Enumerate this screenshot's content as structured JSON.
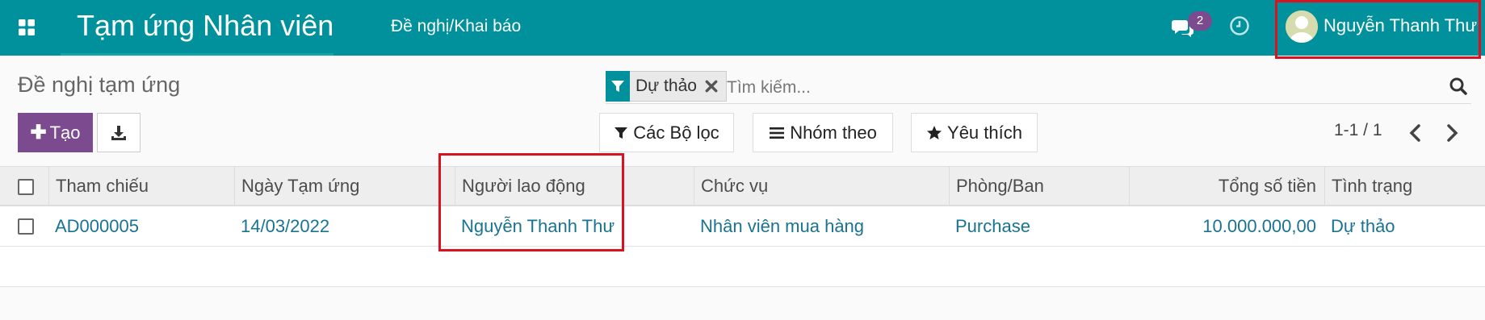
{
  "navbar": {
    "app_title": "Tạm ứng Nhân viên",
    "menu_item": "Đề nghị/Khai báo",
    "messages_count": "2",
    "user_name": "Nguyễn Thanh Thư",
    "bg_color": "#00919c"
  },
  "control_panel": {
    "breadcrumb": "Đề nghị tạm ứng",
    "search": {
      "facet_value": "Dự thảo",
      "placeholder": "Tìm kiếm..."
    },
    "create_label": "Tạo",
    "filters_label": "Các Bộ lọc",
    "group_by_label": "Nhóm theo",
    "favorites_label": "Yêu thích",
    "pager": "1-1 / 1",
    "accent_color": "#7c4a8f"
  },
  "table": {
    "columns": [
      "Tham chiếu",
      "Ngày Tạm ứng",
      "Người lao động",
      "Chức vụ",
      "Phòng/Ban",
      "Tổng số tiền",
      "Tình trạng"
    ],
    "rows": [
      {
        "reference": "AD000005",
        "date": "14/03/2022",
        "employee": "Nguyễn Thanh Thư",
        "position": "Nhân viên mua hàng",
        "department": "Purchase",
        "amount": "10.000.000,00",
        "status": "Dự thảo"
      }
    ]
  }
}
